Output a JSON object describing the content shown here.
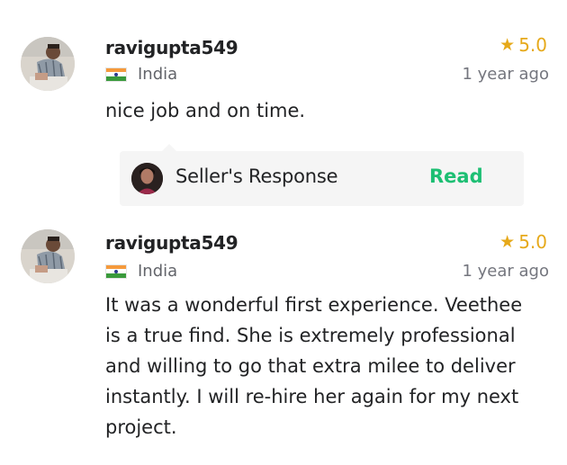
{
  "reviews": [
    {
      "username": "ravigupta549",
      "country": "India",
      "rating": "5.0",
      "time_ago": "1 year ago",
      "text": "nice job and on time.",
      "seller_response": {
        "label": "Seller's Response",
        "action": "Read"
      }
    },
    {
      "username": "ravigupta549",
      "country": "India",
      "rating": "5.0",
      "time_ago": "1 year ago",
      "text": "It was a wonderful first experience. Veethee is a true find. She is extremely professional and willing to go that extra milee to deliver instantly. I will re-hire her again for my next project."
    }
  ],
  "colors": {
    "accent_green": "#1dbf73",
    "star": "#e6a91a",
    "muted": "#74767e"
  },
  "icons": {
    "star": "star-icon",
    "flag": "india-flag-icon"
  }
}
